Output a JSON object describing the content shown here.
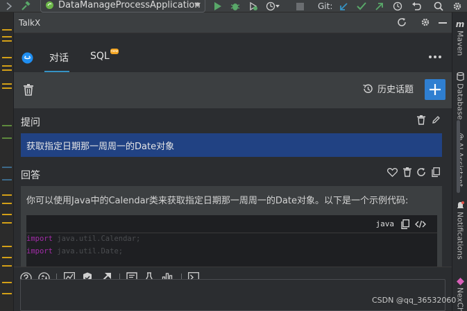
{
  "ide": {
    "run_config": "DataManageProcessApplication",
    "vcs_label": "Git:"
  },
  "right_tools": {
    "maven": "Maven",
    "database": "Database",
    "ai_assistant": "AI Assistant",
    "notifications": "Notifications",
    "nexchat": "NexCh"
  },
  "panel": {
    "title": "TalkX",
    "tabs": {
      "chat": "对话",
      "sql": "SQL",
      "sql_badge": "new"
    },
    "history_label": "历史话题",
    "question_header": "提问",
    "question_text": "获取指定日期那一周周一的Date对象",
    "answer_header": "回答",
    "answer_text": "你可以使用Java中的Calendar类来获取指定日期那一周周一的Date对象。以下是一个示例代码:",
    "code": {
      "language": "java",
      "lines": [
        {
          "keyword": "import",
          "rest": " java.util.Calendar;"
        },
        {
          "keyword": "import",
          "rest": " java.util.Date;"
        }
      ]
    }
  },
  "watermark": "CSDN @qq_36532060",
  "colors": {
    "accent_blue": "#2f7fd1",
    "question_bg": "#214283",
    "keyword": "#a22ca8",
    "run_green": "#59a869"
  }
}
